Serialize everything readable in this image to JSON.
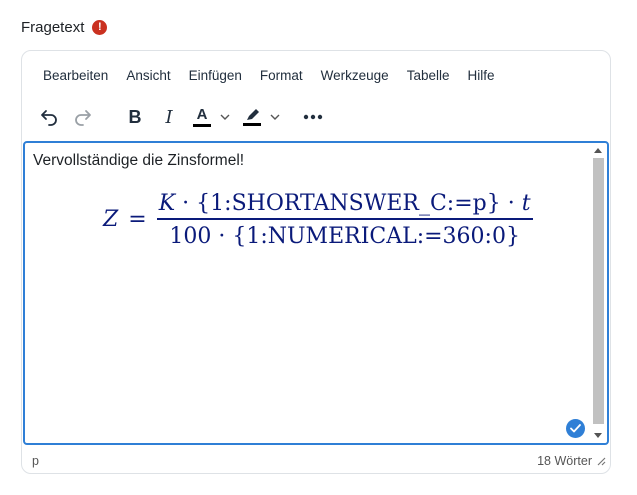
{
  "field": {
    "label": "Fragetext",
    "required_icon": "!"
  },
  "menubar": {
    "items": [
      "Bearbeiten",
      "Ansicht",
      "Einfügen",
      "Format",
      "Werkzeuge",
      "Tabelle",
      "Hilfe"
    ]
  },
  "toolbar": {
    "undo_icon": "undo-icon",
    "redo_icon": "redo-icon",
    "bold_label": "B",
    "italic_label": "I",
    "text_color_label": "A",
    "text_color": "#000000",
    "highlight_icon": "highlight-pen-icon",
    "highlight_color": "#000000",
    "more_icon": "more-horizontal-icon"
  },
  "content": {
    "text": "Vervollständige die Zinsformel!",
    "formula": {
      "lhs": "Z",
      "equals": "=",
      "numerator_k": "K",
      "dot": "·",
      "numerator_mid": "{1:SHORTANSWER_C:=p}",
      "numerator_t": "t",
      "denominator_100": "100",
      "denominator_mid": "{1:NUMERICAL:=360:0}"
    }
  },
  "statusbar": {
    "path": "p",
    "word_count": "18 Wörter"
  },
  "colors": {
    "accent": "#2f7fd6",
    "required": "#ca3120",
    "formula": "#0a1a7a"
  }
}
